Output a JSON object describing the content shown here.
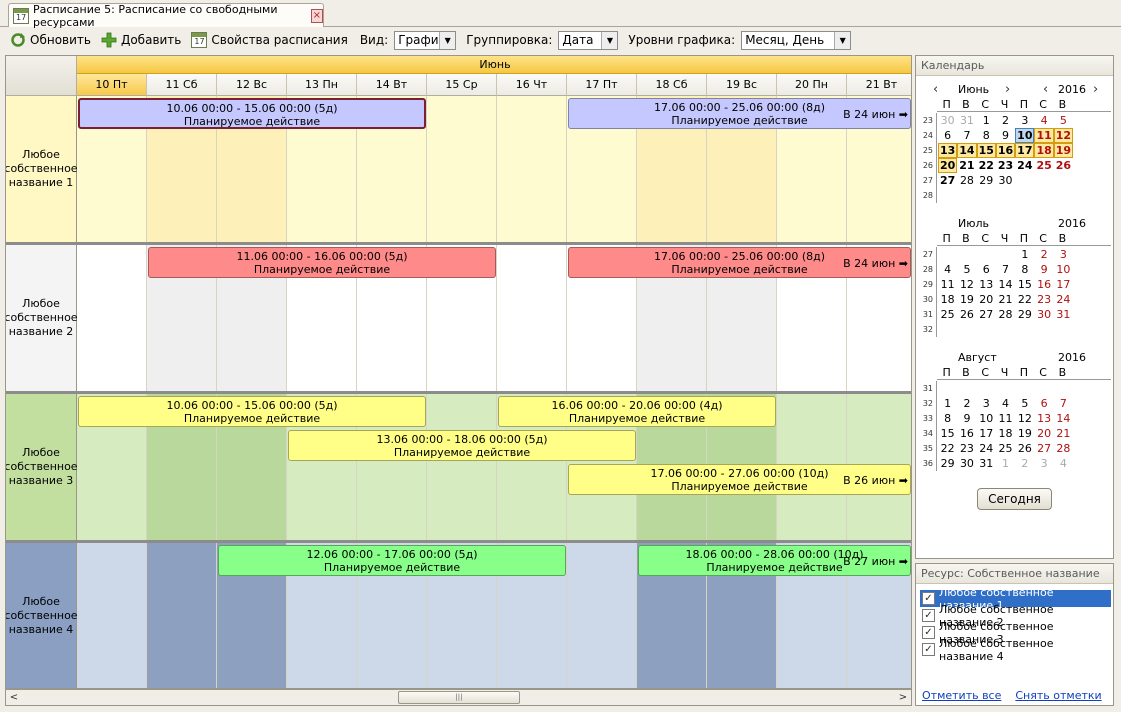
{
  "tab": {
    "title": "Расписание 5: Расписание со свободными ресурсами",
    "close": "×",
    "icon_day": "17"
  },
  "toolbar": {
    "refresh": "Обновить",
    "add": "Добавить",
    "props": "Свойства расписания",
    "view_label": "Вид:",
    "view_value": "График",
    "group_label": "Группировка:",
    "group_value": "Дата",
    "levels_label": "Уровни графика:",
    "levels_value": "Месяц, День"
  },
  "schedule": {
    "month": "Июнь",
    "days": [
      "10 Пт",
      "11 Сб",
      "12 Вс",
      "13 Пн",
      "14 Вт",
      "15 Ср",
      "16 Чт",
      "17 Пт",
      "18 Сб",
      "19 Вс",
      "20 Пн",
      "21 Вт"
    ],
    "groups": [
      {
        "label": "Любое собственное название 1",
        "bars": [
          {
            "range": "10.06 00:00 - 15.06 00:00 (5д)",
            "title": "Планируемое действие"
          },
          {
            "range": "17.06 00:00 - 25.06 00:00 (8д)",
            "title": "Планируемое действие",
            "more": "В 24 июн"
          }
        ]
      },
      {
        "label": "Любое собственное название 2",
        "bars": [
          {
            "range": "11.06 00:00 - 16.06 00:00 (5д)",
            "title": "Планируемое действие"
          },
          {
            "range": "17.06 00:00 - 25.06 00:00 (8д)",
            "title": "Планируемое действие",
            "more": "В 24 июн"
          }
        ]
      },
      {
        "label": "Любое собственное название 3",
        "bars": [
          {
            "range": "10.06 00:00 - 15.06 00:00 (5д)",
            "title": "Планируемое действие"
          },
          {
            "range": "16.06 00:00 - 20.06 00:00 (4д)",
            "title": "Планируемое действие"
          },
          {
            "range": "13.06 00:00 - 18.06 00:00 (5д)",
            "title": "Планируемое действие"
          },
          {
            "range": "17.06 00:00 - 27.06 00:00 (10д)",
            "title": "Планируемое действие",
            "more": "В 26 июн"
          }
        ]
      },
      {
        "label": "Любое собственное название 4",
        "bars": [
          {
            "range": "12.06 00:00 - 17.06 00:00 (5д)",
            "title": "Планируемое действие"
          },
          {
            "range": "18.06 00:00 - 28.06 00:00 (10д)",
            "title": "Планируемое действие",
            "more": "В 27 июн"
          }
        ]
      }
    ]
  },
  "calendar": {
    "title": "Календарь",
    "dow": [
      "П",
      "В",
      "С",
      "Ч",
      "П",
      "С",
      "В"
    ],
    "months": [
      {
        "name": "Июнь",
        "year": "2016",
        "weeks": [
          "23",
          "24",
          "25",
          "26",
          "27",
          "28"
        ],
        "rows": [
          [
            "30",
            "31",
            "1",
            "2",
            "3",
            "4",
            "5"
          ],
          [
            "6",
            "7",
            "8",
            "9",
            "10",
            "11",
            "12"
          ],
          [
            "13",
            "14",
            "15",
            "16",
            "17",
            "18",
            "19"
          ],
          [
            "20",
            "21",
            "22",
            "23",
            "24",
            "25",
            "26"
          ],
          [
            "27",
            "28",
            "29",
            "30",
            "",
            "",
            ""
          ],
          [
            "",
            "",
            "",
            "",
            "",
            "",
            ""
          ]
        ]
      },
      {
        "name": "Июль",
        "year": "2016",
        "weeks": [
          "27",
          "28",
          "29",
          "30",
          "31",
          "32"
        ],
        "rows": [
          [
            "",
            "",
            "",
            "",
            "1",
            "2",
            "3"
          ],
          [
            "4",
            "5",
            "6",
            "7",
            "8",
            "9",
            "10"
          ],
          [
            "11",
            "12",
            "13",
            "14",
            "15",
            "16",
            "17"
          ],
          [
            "18",
            "19",
            "20",
            "21",
            "22",
            "23",
            "24"
          ],
          [
            "25",
            "26",
            "27",
            "28",
            "29",
            "30",
            "31"
          ],
          [
            "",
            "",
            "",
            "",
            "",
            "",
            ""
          ]
        ]
      },
      {
        "name": "Август",
        "year": "2016",
        "weeks": [
          "31",
          "32",
          "33",
          "34",
          "35",
          "36"
        ],
        "rows": [
          [
            "",
            "",
            "",
            "",
            "",
            "",
            ""
          ],
          [
            "1",
            "2",
            "3",
            "4",
            "5",
            "6",
            "7"
          ],
          [
            "8",
            "9",
            "10",
            "11",
            "12",
            "13",
            "14"
          ],
          [
            "15",
            "16",
            "17",
            "18",
            "19",
            "20",
            "21"
          ],
          [
            "22",
            "23",
            "24",
            "25",
            "26",
            "27",
            "28"
          ],
          [
            "29",
            "30",
            "31",
            "1",
            "2",
            "3",
            "4"
          ]
        ]
      }
    ],
    "today_button": "Сегодня"
  },
  "resources": {
    "title": "Ресурс: Собственное название",
    "items": [
      "Любое собственное название 1",
      "Любое собственное название 2",
      "Любое собственное название 3",
      "Любое собственное название 4"
    ],
    "check_all": "Отметить все",
    "uncheck_all": "Снять отметки"
  },
  "colors": {
    "g1_bg": "#fffbd0",
    "g1_wk": "#fdf0b8",
    "g1_label": "#fff7c4",
    "g2_bg": "#ffffff",
    "g2_wk": "#efefef",
    "g2_label": "#f4f4f4",
    "g3_bg": "#d6ebc0",
    "g3_wk": "#b8d89c",
    "g3_label": "#c2df9f",
    "g4_bg": "#cdd8e8",
    "g4_wk": "#8da0c0",
    "g4_label": "#8a9fc2",
    "bar_purple": "#c5c8ff",
    "bar_red": "#ff8a8a",
    "bar_yellow": "#ffff88",
    "bar_green": "#88ff88"
  }
}
